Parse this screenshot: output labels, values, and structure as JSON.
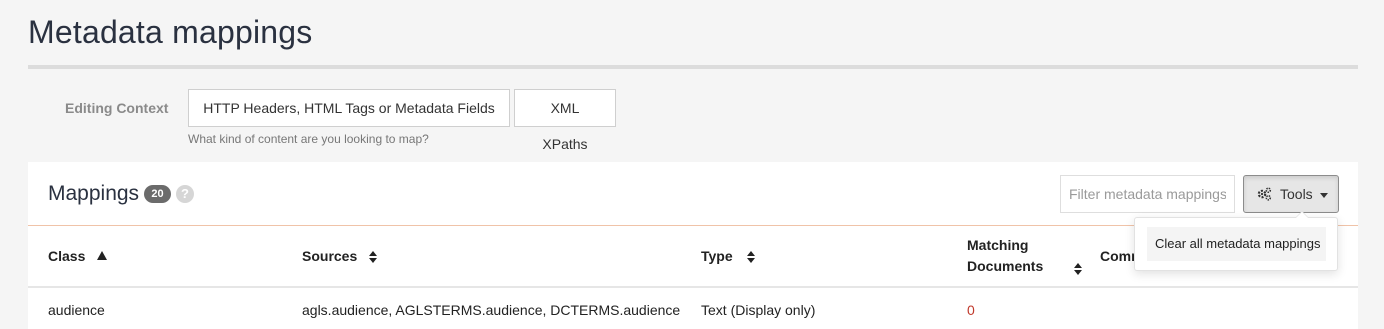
{
  "page": {
    "title": "Metadata mappings"
  },
  "editing_context": {
    "label": "Editing Context",
    "options": [
      "HTTP Headers, HTML Tags or Metadata Fields",
      "XML XPaths"
    ],
    "help": "What kind of content are you looking to map?"
  },
  "panel": {
    "title": "Mappings",
    "count": "20",
    "help_icon": "question-icon",
    "filter_placeholder": "Filter metadata mappings",
    "tools_label": "Tools",
    "tools_icon": "gears-icon",
    "dropdown_items": [
      "Clear all metadata mappings"
    ]
  },
  "table": {
    "columns": [
      {
        "label": "Class",
        "sort": "ascending"
      },
      {
        "label": "Sources",
        "sort": "sortable"
      },
      {
        "label": "Type",
        "sort": "sortable"
      },
      {
        "label": "Matching Documents",
        "sort": "sortable"
      },
      {
        "label": "Comm",
        "sort": "none"
      }
    ],
    "matching_line1": "Matching",
    "matching_line2": "Documents",
    "rows": [
      {
        "class": "audience",
        "sources": "agls.audience, AGLSTERMS.audience, DCTERMS.audience",
        "type": "Text (Display only)",
        "matching": "0"
      }
    ]
  },
  "colors": {
    "accent_rule": "#f0c3a8",
    "zero_count": "#c0392b",
    "badge": "#6b6b6b"
  }
}
